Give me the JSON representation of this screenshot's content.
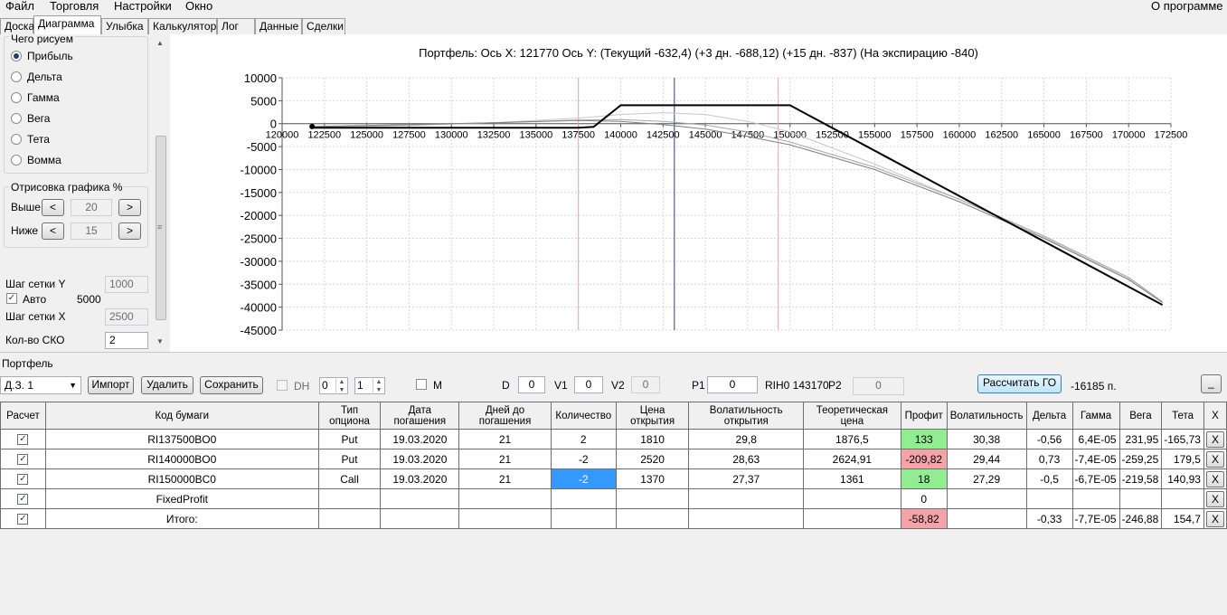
{
  "menu": {
    "items": [
      "Файл",
      "Торговля",
      "Настройки",
      "Окно"
    ],
    "about": "О программе"
  },
  "tabs": [
    "Доска",
    "Диаграмма",
    "Улыбка",
    "Калькулятор",
    "Лог",
    "Данные",
    "Сделки"
  ],
  "active_tab": "Диаграмма",
  "left_panel": {
    "what_group": "Чего рисуем",
    "radios": [
      {
        "label": "Прибыль",
        "checked": true
      },
      {
        "label": "Дельта",
        "checked": false
      },
      {
        "label": "Гамма",
        "checked": false
      },
      {
        "label": "Вега",
        "checked": false
      },
      {
        "label": "Тета",
        "checked": false
      },
      {
        "label": "Вомма",
        "checked": false
      }
    ],
    "draw_group": "Отрисовка графика %",
    "above_label": "Выше",
    "above_value": "20",
    "below_label": "Ниже",
    "below_value": "15",
    "dec_label": "<",
    "inc_label": ">",
    "grid_y_label": "Шаг сетки Y",
    "grid_y_value": "1000",
    "auto_label": "Авто",
    "auto_checked": true,
    "auto_value": "5000",
    "grid_x_label": "Шаг сетки X",
    "grid_x_value": "2500",
    "sko_label": "Кол-во СКО",
    "sko_value": "2"
  },
  "chart_header": {
    "title": "Портфель: Ось X:  121770 Ось Y:  (Текущий -632,4)  (+3 дн. -688,12)  (+15 дн. -837)  (На экспирацию -840)"
  },
  "chart_data": {
    "type": "line",
    "xlim": [
      120000,
      172500
    ],
    "ylim": [
      -45000,
      10000
    ],
    "x_ticks": [
      120000,
      122500,
      125000,
      127500,
      130000,
      132500,
      135000,
      137500,
      140000,
      142500,
      145000,
      147500,
      150000,
      152500,
      155000,
      157500,
      160000,
      162500,
      165000,
      167500,
      170000,
      172500
    ],
    "y_ticks": [
      10000,
      5000,
      0,
      -5000,
      -10000,
      -15000,
      -20000,
      -25000,
      -30000,
      -35000,
      -40000,
      -45000
    ],
    "grid": true,
    "vertical_markers": [
      {
        "x": 137500,
        "color": "#f2a6a6"
      },
      {
        "x": 143170,
        "color": "#3a3a8a"
      },
      {
        "x": 149300,
        "color": "#f2a6a6"
      }
    ],
    "marker_point": {
      "x": 121770,
      "y": -632
    },
    "series": [
      {
        "color": "#000000",
        "width": 2,
        "x": [
          121770,
          137500,
          138400,
          140000,
          150000,
          172000
        ],
        "y": [
          -900,
          -900,
          -700,
          4000,
          4000,
          -39500
        ]
      },
      {
        "color": "#808080",
        "width": 1,
        "x": [
          121770,
          127500,
          132500,
          137500,
          140000,
          142500,
          145000,
          147500,
          150000,
          155000,
          160000,
          165000,
          170000,
          172000
        ],
        "y": [
          -632,
          -200,
          200,
          700,
          500,
          -200,
          -1200,
          -2800,
          -4600,
          -10000,
          -17000,
          -25000,
          -34000,
          -39000
        ]
      },
      {
        "color": "#a6a6a6",
        "width": 1,
        "x": [
          121770,
          127500,
          132500,
          137500,
          140000,
          142500,
          145000,
          147500,
          150000,
          155000,
          160000,
          165000,
          170000,
          172000
        ],
        "y": [
          -688,
          -300,
          200,
          800,
          900,
          500,
          -300,
          -1800,
          -4000,
          -9500,
          -16500,
          -24500,
          -33500,
          -38800
        ]
      },
      {
        "color": "#c8c8c8",
        "width": 1,
        "x": [
          121770,
          127500,
          132500,
          137500,
          140000,
          142500,
          145000,
          147500,
          150000,
          155000,
          160000,
          165000,
          170000,
          172000
        ],
        "y": [
          -837,
          -400,
          200,
          1200,
          2000,
          2400,
          2000,
          500,
          -1800,
          -8800,
          -16500,
          -24800,
          -33800,
          -38900
        ]
      }
    ]
  },
  "portfolio": {
    "label": "Портфель",
    "account": "Д.З. 1",
    "import_label": "Импорт",
    "delete_label": "Удалить",
    "save_label": "Сохранить",
    "dh_label": "DH",
    "spin1": "0",
    "spin2": "1",
    "m_label": "M",
    "d_label": "D",
    "d_value": "0",
    "v1_label": "V1",
    "v1_value": "0",
    "v2_label": "V2",
    "v2_value": "0",
    "p1_label": "P1",
    "p1_value": "0",
    "rih_label": "RIH0 143170",
    "p2_label": "P2",
    "p2_value": "0",
    "calc_label": "Рассчитать ГО",
    "go_value": "-16185 п.",
    "minimize_label": "_"
  },
  "grid": {
    "headers": [
      "Расчет",
      "Код бумаги",
      "Тип опциона",
      "Дата погашения",
      "Дней до погашения",
      "Количество",
      "Цена открытия",
      "Волатильность открытия",
      "Теоретическая цена",
      "Профит",
      "Волатильность",
      "Дельта",
      "Гамма",
      "Вега",
      "Тета",
      "X"
    ],
    "rows": [
      {
        "calc": true,
        "code": "RI137500BO0",
        "type": "Put",
        "date": "19.03.2020",
        "days": "21",
        "qty": "2",
        "open_price": "1810",
        "open_vol": "29,8",
        "theor": "1876,5",
        "profit": "133",
        "profit_color": "green",
        "vol": "30,38",
        "delta": "-0,56",
        "gamma": "6,4E-05",
        "vega": "231,95",
        "theta": "-165,73",
        "x": "X",
        "qty_sel": false
      },
      {
        "calc": true,
        "code": "RI140000BO0",
        "type": "Put",
        "date": "19.03.2020",
        "days": "21",
        "qty": "-2",
        "open_price": "2520",
        "open_vol": "28,63",
        "theor": "2624,91",
        "profit": "-209,82",
        "profit_color": "pink",
        "vol": "29,44",
        "delta": "0,73",
        "gamma": "-7,4E-05",
        "vega": "-259,25",
        "theta": "179,5",
        "x": "X",
        "qty_sel": false
      },
      {
        "calc": true,
        "code": "RI150000BC0",
        "type": "Call",
        "date": "19.03.2020",
        "days": "21",
        "qty": "-2",
        "open_price": "1370",
        "open_vol": "27,37",
        "theor": "1361",
        "profit": "18",
        "profit_color": "green",
        "vol": "27,29",
        "delta": "-0,5",
        "gamma": "-6,7E-05",
        "vega": "-219,58",
        "theta": "140,93",
        "x": "X",
        "qty_sel": true
      },
      {
        "calc": true,
        "code": "FixedProfit",
        "type": "",
        "date": "",
        "days": "",
        "qty": "",
        "open_price": "",
        "open_vol": "",
        "theor": "",
        "profit": "0",
        "profit_color": "",
        "vol": "",
        "delta": "",
        "gamma": "",
        "vega": "",
        "theta": "",
        "x": "X",
        "qty_sel": false
      },
      {
        "calc": true,
        "code": "Итого:",
        "type": "",
        "date": "",
        "days": "",
        "qty": "",
        "open_price": "",
        "open_vol": "",
        "theor": "",
        "profit": "-58,82",
        "profit_color": "pink",
        "vol": "",
        "delta": "-0,33",
        "gamma": "-7,7E-05",
        "vega": "-246,88",
        "theta": "154,7",
        "x": "X",
        "qty_sel": false
      }
    ]
  },
  "colors": {
    "profit_positive": "#90ee90",
    "profit_negative": "#f4a3a8",
    "selection": "#3399ff"
  }
}
